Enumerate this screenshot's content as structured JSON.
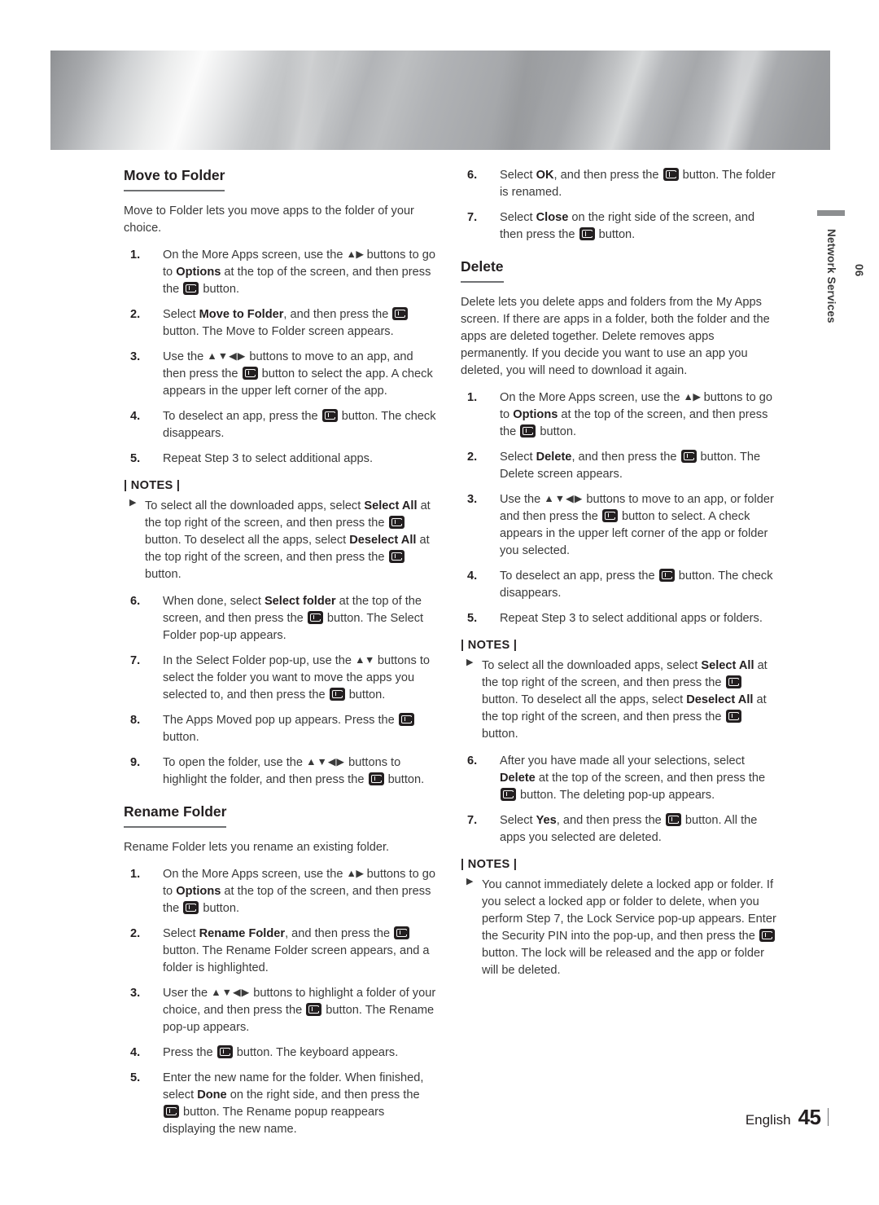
{
  "banner": {
    "name": "metallic-header-band"
  },
  "side_tab": {
    "chapter_number": "06",
    "chapter_title": "Network Services"
  },
  "footer": {
    "language": "English",
    "page_number": "45"
  },
  "left_column": {
    "section1": {
      "heading": "Move to Folder",
      "intro": "Move to Folder lets you move apps to the folder of your choice.",
      "steps": [
        {
          "num": "1.",
          "html": "On the More Apps screen, use the <span class=\"arrows\">▲▶</span> buttons to go to <b>Options</b> at the top of the screen, and then press the <span class=\"ebtn\" data-name=\"enter-button-icon\"></span> button."
        },
        {
          "num": "2.",
          "html": "Select <b>Move to Folder</b>, and then press the <span class=\"ebtn\" data-name=\"enter-button-icon\"></span> button. The Move to Folder screen appears."
        },
        {
          "num": "3.",
          "html": "Use the <span class=\"arrows sp\">▲▼◀▶</span> buttons to move to an app, and then press the <span class=\"ebtn\" data-name=\"enter-button-icon\"></span> button to select the app. A check appears in the upper left corner of the app."
        },
        {
          "num": "4.",
          "html": "To deselect an app, press the <span class=\"ebtn\" data-name=\"enter-button-icon\"></span> button. The check disappears."
        },
        {
          "num": "5.",
          "html": "Repeat Step 3 to select additional apps."
        }
      ],
      "notes_label": "| NOTES |",
      "notes": [
        "To select all the downloaded apps, select <b>Select All</b> at the top right of the screen, and then press the <span class=\"ebtn\" data-name=\"enter-button-icon\"></span> button. To deselect all the apps, select <b>Deselect All</b> at the top right of the screen, and then press the <span class=\"ebtn\" data-name=\"enter-button-icon\"></span> button."
      ],
      "steps_after_notes": [
        {
          "num": "6.",
          "html": "When done, select <b>Select folder</b> at the top of the screen, and then press the <span class=\"ebtn\" data-name=\"enter-button-icon\"></span> button. The Select Folder pop-up appears."
        },
        {
          "num": "7.",
          "html": "In the Select Folder pop-up, use the <span class=\"arrows\">▲▼</span> buttons to select the folder you want to move the apps you selected to, and then press the <span class=\"ebtn\" data-name=\"enter-button-icon\"></span> button."
        },
        {
          "num": "8.",
          "html": "The Apps Moved pop up appears. Press the <span class=\"ebtn\" data-name=\"enter-button-icon\"></span> button."
        },
        {
          "num": "9.",
          "html": "To open the folder, use the <span class=\"arrows sp\">▲▼◀▶</span> buttons to highlight the folder, and then press the <span class=\"ebtn\" data-name=\"enter-button-icon\"></span> button."
        }
      ]
    },
    "section2": {
      "heading": "Rename Folder",
      "intro": "Rename Folder lets you rename an existing folder.",
      "steps": [
        {
          "num": "1.",
          "html": "On the More Apps screen, use the <span class=\"arrows\">▲▶</span> buttons to go to <b>Options</b> at the top of the screen, and then press the <span class=\"ebtn\" data-name=\"enter-button-icon\"></span> button."
        },
        {
          "num": "2.",
          "html": "Select <b>Rename Folder</b>, and then press the <span class=\"ebtn\" data-name=\"enter-button-icon\"></span> button. The Rename Folder screen appears, and a folder is highlighted."
        },
        {
          "num": "3.",
          "html": "User the <span class=\"arrows sp\">▲▼◀▶</span> buttons to highlight a folder of your choice, and then press the <span class=\"ebtn\" data-name=\"enter-button-icon\"></span> button. The Rename pop-up appears."
        },
        {
          "num": "4.",
          "html": "Press the <span class=\"ebtn\" data-name=\"enter-button-icon\"></span> button. The keyboard appears."
        },
        {
          "num": "5.",
          "html": "Enter the new name for the folder. When finished, select <b>Done</b> on the right side, and then press the <span class=\"ebtn\" data-name=\"enter-button-icon\"></span> button. The Rename popup reappears displaying the new name."
        }
      ]
    }
  },
  "right_column": {
    "continued_steps": [
      {
        "num": "6.",
        "html": "Select <b>OK</b>, and then press the <span class=\"ebtn\" data-name=\"enter-button-icon\"></span> button. The folder is renamed."
      },
      {
        "num": "7.",
        "html": "Select <b>Close</b> on the right side of the screen, and then press the <span class=\"ebtn\" data-name=\"enter-button-icon\"></span> button."
      }
    ],
    "section1": {
      "heading": "Delete",
      "intro": "Delete lets you delete apps and folders from the My Apps screen. If there are apps in a folder, both the folder and the apps are deleted together. Delete removes apps permanently. If you decide you want to use an app you deleted, you will need to download it again.",
      "steps": [
        {
          "num": "1.",
          "html": "On the More Apps screen, use the <span class=\"arrows\">▲▶</span> buttons to go to <b>Options</b> at the top of the screen, and then press the <span class=\"ebtn\" data-name=\"enter-button-icon\"></span> button."
        },
        {
          "num": "2.",
          "html": "Select <b>Delete</b>, and then press the <span class=\"ebtn\" data-name=\"enter-button-icon\"></span> button. The Delete screen appears."
        },
        {
          "num": "3.",
          "html": "Use the <span class=\"arrows sp\">▲▼◀▶</span> buttons to move to an app, or folder and then press the <span class=\"ebtn\" data-name=\"enter-button-icon\"></span> button to select. A check appears in the upper left corner of the app or folder you selected."
        },
        {
          "num": "4.",
          "html": "To deselect an app, press the <span class=\"ebtn\" data-name=\"enter-button-icon\"></span> button. The check disappears."
        },
        {
          "num": "5.",
          "html": "Repeat Step 3 to select additional apps or folders."
        }
      ],
      "notes_label": "| NOTES |",
      "notes": [
        "To select all the downloaded apps, select <b>Select All</b> at the top right of the screen, and then press the <span class=\"ebtn\" data-name=\"enter-button-icon\"></span> button. To deselect all the apps, select <b>Deselect All</b> at the top right of the screen, and then press the <span class=\"ebtn\" data-name=\"enter-button-icon\"></span> button."
      ],
      "steps_after_notes": [
        {
          "num": "6.",
          "html": "After you have made all your selections, select <b>Delete</b> at the top of the screen, and then press the <span class=\"ebtn\" data-name=\"enter-button-icon\"></span> button. The deleting pop-up appears."
        },
        {
          "num": "7.",
          "html": "Select <b>Yes</b>, and then press the <span class=\"ebtn\" data-name=\"enter-button-icon\"></span> button. All the apps you selected are deleted."
        }
      ],
      "notes2_label": "| NOTES |",
      "notes2": [
        "You cannot immediately delete a locked app or folder. If you select a locked app or folder to delete, when you perform Step 7, the Lock Service pop-up appears. Enter the Security PIN into the pop-up, and then press the <span class=\"ebtn\" data-name=\"enter-button-icon\"></span> button. The lock will be released and the app or folder will be deleted."
      ]
    }
  }
}
